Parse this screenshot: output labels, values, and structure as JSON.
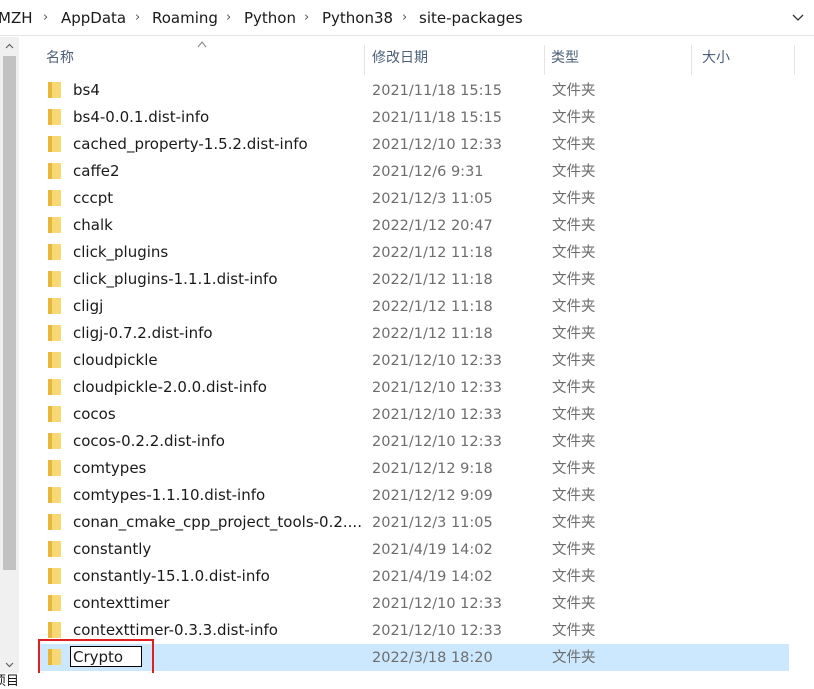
{
  "breadcrumb": {
    "items": [
      "MZH",
      "AppData",
      "Roaming",
      "Python",
      "Python38",
      "site-packages"
    ],
    "separator": "›"
  },
  "columns": {
    "name": "名称",
    "modified": "修改日期",
    "type": "类型",
    "size": "大小"
  },
  "files": [
    {
      "name": "bs4",
      "modified": "2021/11/18 15:15",
      "type": "文件夹"
    },
    {
      "name": "bs4-0.0.1.dist-info",
      "modified": "2021/11/18 15:15",
      "type": "文件夹"
    },
    {
      "name": "cached_property-1.5.2.dist-info",
      "modified": "2021/12/10 12:33",
      "type": "文件夹"
    },
    {
      "name": "caffe2",
      "modified": "2021/12/6 9:31",
      "type": "文件夹"
    },
    {
      "name": "cccpt",
      "modified": "2021/12/3 11:05",
      "type": "文件夹"
    },
    {
      "name": "chalk",
      "modified": "2022/1/12 20:47",
      "type": "文件夹"
    },
    {
      "name": "click_plugins",
      "modified": "2022/1/12 11:18",
      "type": "文件夹"
    },
    {
      "name": "click_plugins-1.1.1.dist-info",
      "modified": "2022/1/12 11:18",
      "type": "文件夹"
    },
    {
      "name": "cligj",
      "modified": "2022/1/12 11:18",
      "type": "文件夹"
    },
    {
      "name": "cligj-0.7.2.dist-info",
      "modified": "2022/1/12 11:18",
      "type": "文件夹"
    },
    {
      "name": "cloudpickle",
      "modified": "2021/12/10 12:33",
      "type": "文件夹"
    },
    {
      "name": "cloudpickle-2.0.0.dist-info",
      "modified": "2021/12/10 12:33",
      "type": "文件夹"
    },
    {
      "name": "cocos",
      "modified": "2021/12/10 12:33",
      "type": "文件夹"
    },
    {
      "name": "cocos-0.2.2.dist-info",
      "modified": "2021/12/10 12:33",
      "type": "文件夹"
    },
    {
      "name": "comtypes",
      "modified": "2021/12/12 9:18",
      "type": "文件夹"
    },
    {
      "name": "comtypes-1.1.10.dist-info",
      "modified": "2021/12/12 9:09",
      "type": "文件夹"
    },
    {
      "name": "conan_cmake_cpp_project_tools-0.2....",
      "modified": "2021/12/3 11:05",
      "type": "文件夹"
    },
    {
      "name": "constantly",
      "modified": "2021/4/19 14:02",
      "type": "文件夹"
    },
    {
      "name": "constantly-15.1.0.dist-info",
      "modified": "2021/4/19 14:02",
      "type": "文件夹"
    },
    {
      "name": "contexttimer",
      "modified": "2021/12/10 12:33",
      "type": "文件夹"
    },
    {
      "name": "contexttimer-0.3.3.dist-info",
      "modified": "2021/12/10 12:33",
      "type": "文件夹"
    }
  ],
  "renaming": {
    "value": "Crypto",
    "modified": "2022/3/18 18:20",
    "type": "文件夹"
  },
  "status": {
    "text": "项目"
  },
  "colors": {
    "selection": "#cce8ff",
    "folder": "#f8d775",
    "folder_dark": "#e8b73a",
    "highlight": "#e02020",
    "header_text": "#4c607a"
  }
}
